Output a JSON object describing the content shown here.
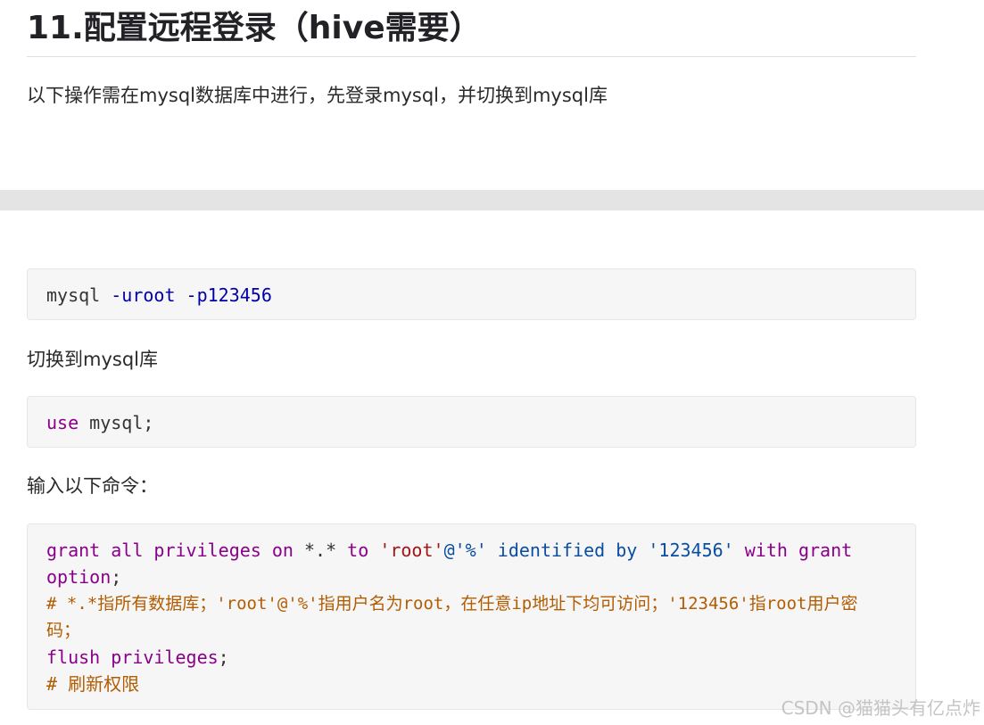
{
  "heading": "11.配置远程登录（hive需要）",
  "intro": "以下操作需在mysql数据库中进行，先登录mysql，并切换到mysql库",
  "code1": {
    "cmd": "mysql ",
    "opt1": "-uroot",
    "sp": " ",
    "opt2": "-p123456"
  },
  "switch_text": "切换到mysql库",
  "code2": {
    "kw": "use",
    "rest": " mysql;"
  },
  "input_text": "输入以下命令：",
  "code3": {
    "l1_kw1": "grant all privileges on",
    "l1_t1": " *.* ",
    "l1_kw2": "to",
    "l1_sp1": " ",
    "l1_s1": "'root'",
    "l1_at": "@",
    "l1_s2": "'%'",
    "l1_sp2": " ",
    "l1_kw3": "identified by",
    "l1_sp3": " ",
    "l1_s3": "'123456'",
    "l1_sp4": " ",
    "l1_kw4": "with grant",
    "l2_kw": "option",
    "l2_t": ";",
    "l3": "# *.*指所有数据库；'root'@'%'指用户名为root，在任意ip地址下均可访问；'123456'指root用户密",
    "l4": "码；",
    "l5_kw": "flush privileges",
    "l5_t": ";",
    "l6": "# 刷新权限"
  },
  "watermark": "CSDN @猫猫头有亿点炸",
  "colors": {
    "keyword": "#8b008b",
    "string": "#a31515",
    "comment": "#b35c00",
    "option": "#0000aa",
    "code_bg": "#f6f6f6"
  }
}
